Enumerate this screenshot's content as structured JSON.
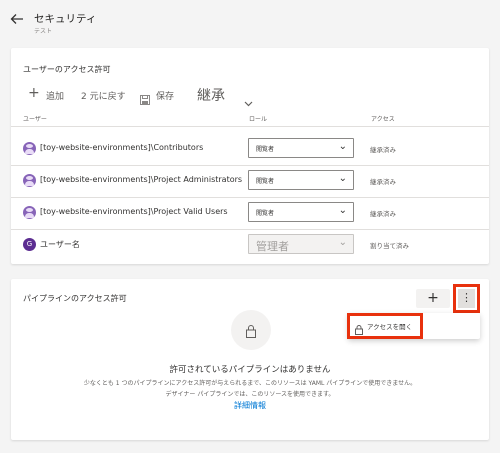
{
  "header": {
    "title": "セキュリティ",
    "subtitle": "テスト"
  },
  "user_permissions": {
    "title": "ユーザーのアクセス許可",
    "toolbar": {
      "add_label": "追加",
      "revert_label": "2 元に戻す",
      "save_label": "保存",
      "inherit_label": "継承"
    },
    "columns": {
      "user": "ユーザー",
      "role": "ロール",
      "access": "アクセス"
    },
    "rows": [
      {
        "name": "[toy-website-environments]\\Contributors",
        "role": "閲覧者",
        "access": "継承済み"
      },
      {
        "name": "[toy-website-environments]\\Project Administrators",
        "role": "閲覧者",
        "access": "継承済み"
      },
      {
        "name": "[toy-website-environments]\\Project Valid Users",
        "role": "閲覧者",
        "access": "継承済み"
      },
      {
        "name": "ユーザー名",
        "avatar_letter": "G",
        "role": "管理者",
        "access": "割り当て済み"
      }
    ]
  },
  "pipeline_permissions": {
    "title": "パイプラインのアクセス許可",
    "menu_item": "アクセスを開く",
    "empty_title": "許可されているパイプラインはありません",
    "empty_line1": "少なくとも 1 つのパイプラインにアクセス許可が与えられるまで、このリソースは YAML パイプラインで使用できません。",
    "empty_line2": "デザイナー パイプラインでは、このリソースを使用できます。",
    "link": "詳細情報"
  },
  "colors": {
    "highlight": "#e8310d",
    "link": "#0078d4",
    "avatar": "#8764b8"
  }
}
